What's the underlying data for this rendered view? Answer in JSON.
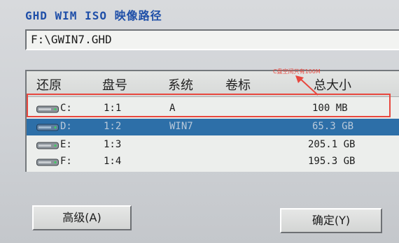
{
  "panel": {
    "title": "GHD WIM ISO 映像路径",
    "path_value": "F:\\GWIN7.GHD"
  },
  "table": {
    "columns": [
      "还原",
      "盘号",
      "系统",
      "卷标",
      "总大小"
    ],
    "rows": [
      {
        "drive": "C:",
        "disk": "1:1",
        "system": "A",
        "label": "",
        "size": "100 MB",
        "selected": false
      },
      {
        "drive": "D:",
        "disk": "1:2",
        "system": "WIN7",
        "label": "",
        "size": "65.3 GB",
        "selected": true
      },
      {
        "drive": "E:",
        "disk": "1:3",
        "system": "",
        "label": "",
        "size": "205.1 GB",
        "selected": false
      },
      {
        "drive": "F:",
        "disk": "1:4",
        "system": "",
        "label": "",
        "size": "195.3 GB",
        "selected": false
      }
    ]
  },
  "annotation": {
    "text": "C盘空间只有100M",
    "color": "#e8473e"
  },
  "buttons": {
    "advanced": "高级(A)",
    "ok": "确定(Y)"
  },
  "icons": {
    "drive": "hard-disk-icon"
  }
}
